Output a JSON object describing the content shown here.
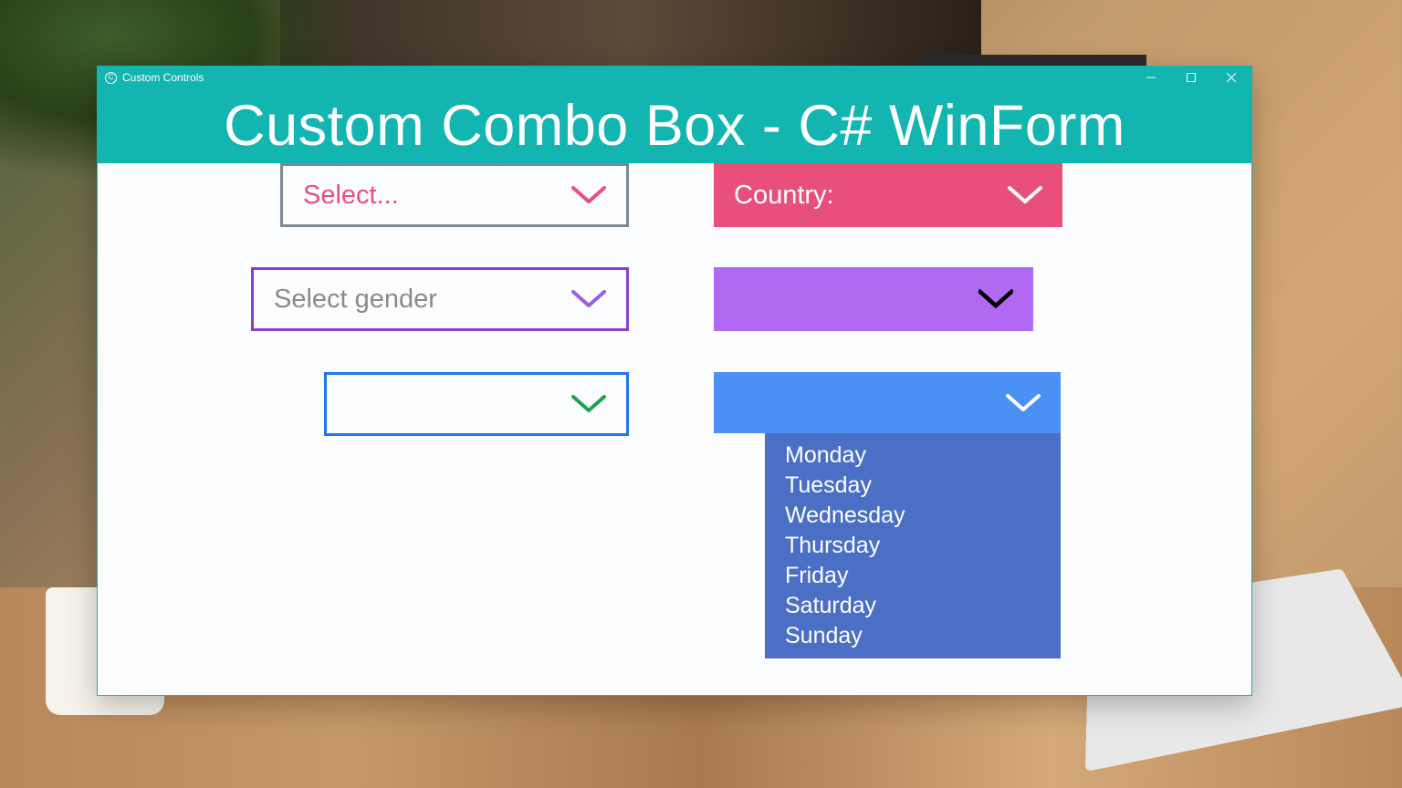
{
  "window": {
    "app_title": "Custom Controls",
    "header_title": "Custom Combo Box - C# WinForm"
  },
  "combos": {
    "select": {
      "label": "Select..."
    },
    "country": {
      "label": "Country:"
    },
    "gender": {
      "label": "Select gender"
    },
    "purple": {
      "label": ""
    },
    "bluegreen": {
      "label": ""
    },
    "day": {
      "label": ""
    }
  },
  "dropdown_days": {
    "items": [
      "Monday",
      "Tuesday",
      "Wednesday",
      "Thursday",
      "Friday",
      "Saturday",
      "Sunday"
    ]
  },
  "colors": {
    "teal": "#13b5b1",
    "pink": "#e84f7a",
    "purple": "#8b3ec9",
    "lilac": "#b168f2",
    "blue": "#1e78e8",
    "green": "#1fa34a",
    "skyblue": "#4a90f5",
    "slate": "#4a6fc4"
  }
}
